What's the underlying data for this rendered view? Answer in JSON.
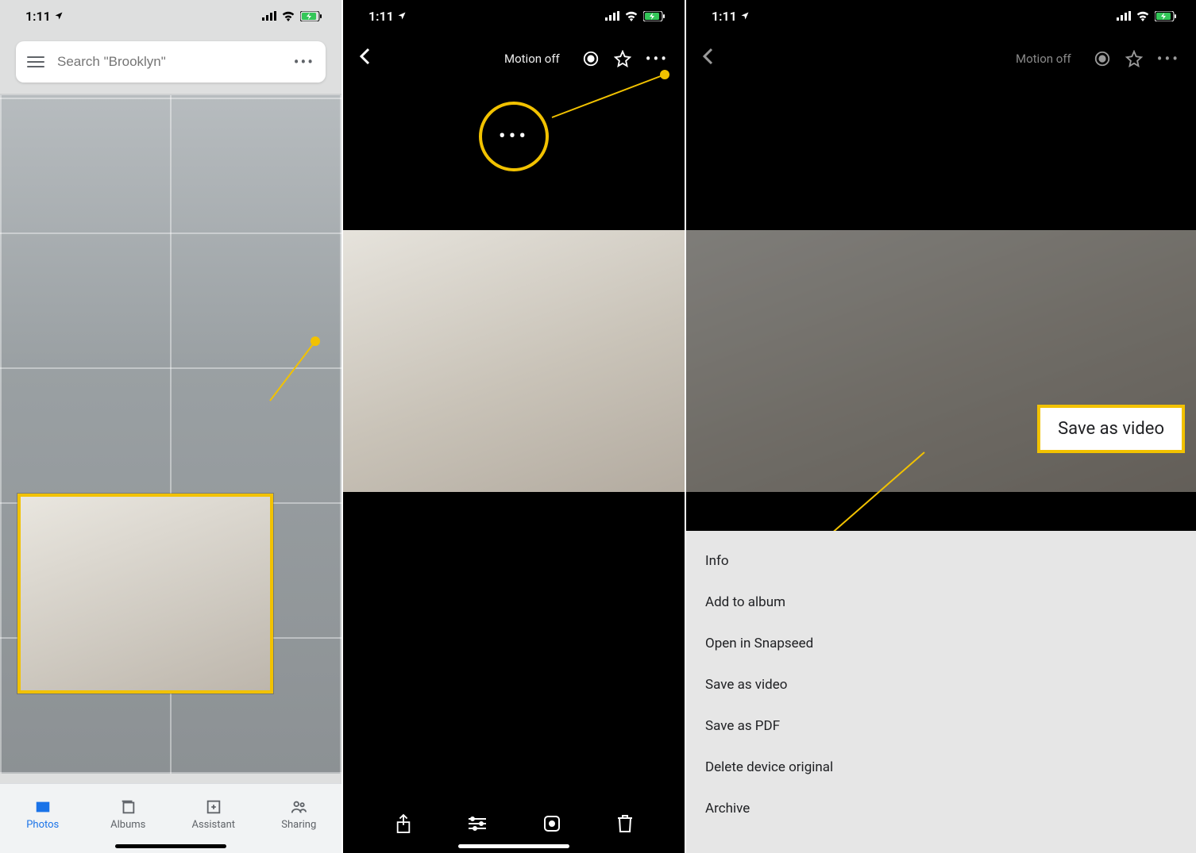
{
  "status": {
    "time": "1:11"
  },
  "screen1": {
    "search_placeholder": "Search \"Brooklyn\"",
    "tabs": {
      "photos": "Photos",
      "albums": "Albums",
      "assistant": "Assistant",
      "sharing": "Sharing"
    }
  },
  "screen2": {
    "motion_label": "Motion off",
    "callout_dots": "•••"
  },
  "screen3": {
    "motion_label": "Motion off",
    "save_label": "Save as video",
    "menu": {
      "info": "Info",
      "add_album": "Add to album",
      "open_snapseed": "Open in Snapseed",
      "save_video": "Save as video",
      "save_pdf": "Save as PDF",
      "delete_original": "Delete device original",
      "archive": "Archive"
    }
  }
}
